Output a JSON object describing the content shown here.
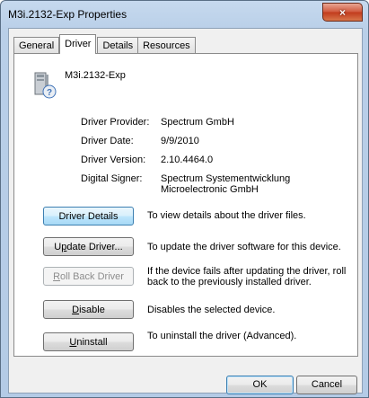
{
  "window": {
    "title": "M3i.2132-Exp Properties",
    "close_label": "×"
  },
  "tabs": [
    {
      "label": "General"
    },
    {
      "label": "Driver"
    },
    {
      "label": "Details"
    },
    {
      "label": "Resources"
    }
  ],
  "device": {
    "name": "M3i.2132-Exp",
    "icon": "device-unknown-icon"
  },
  "info": {
    "provider_label": "Driver Provider:",
    "provider_value": "Spectrum GmbH",
    "date_label": "Driver Date:",
    "date_value": "9/9/2010",
    "version_label": "Driver Version:",
    "version_value": "2.10.4464.0",
    "signer_label": "Digital Signer:",
    "signer_value": "Spectrum Systementwicklung Microelectronic GmbH"
  },
  "actions": {
    "details_label": "Driver Details",
    "details_desc": "To view details about the driver files.",
    "update_label_pre": "U",
    "update_label_key": "p",
    "update_label_post": "date Driver...",
    "update_desc": "To update the driver software for this device.",
    "rollback_label_key": "R",
    "rollback_label_post": "oll Back Driver",
    "rollback_desc": "If the device fails after updating the driver, roll back to the previously installed driver.",
    "disable_label_key": "D",
    "disable_label_post": "isable",
    "disable_desc": "Disables the selected device.",
    "uninstall_label_key": "U",
    "uninstall_label_post": "ninstall",
    "uninstall_desc": "To uninstall the driver (Advanced)."
  },
  "footer": {
    "ok_label": "OK",
    "cancel_label": "Cancel"
  },
  "colors": {
    "title_bar": "#b9cfe8",
    "close_button": "#c13a1c",
    "focus_border": "#3c7fb1"
  }
}
